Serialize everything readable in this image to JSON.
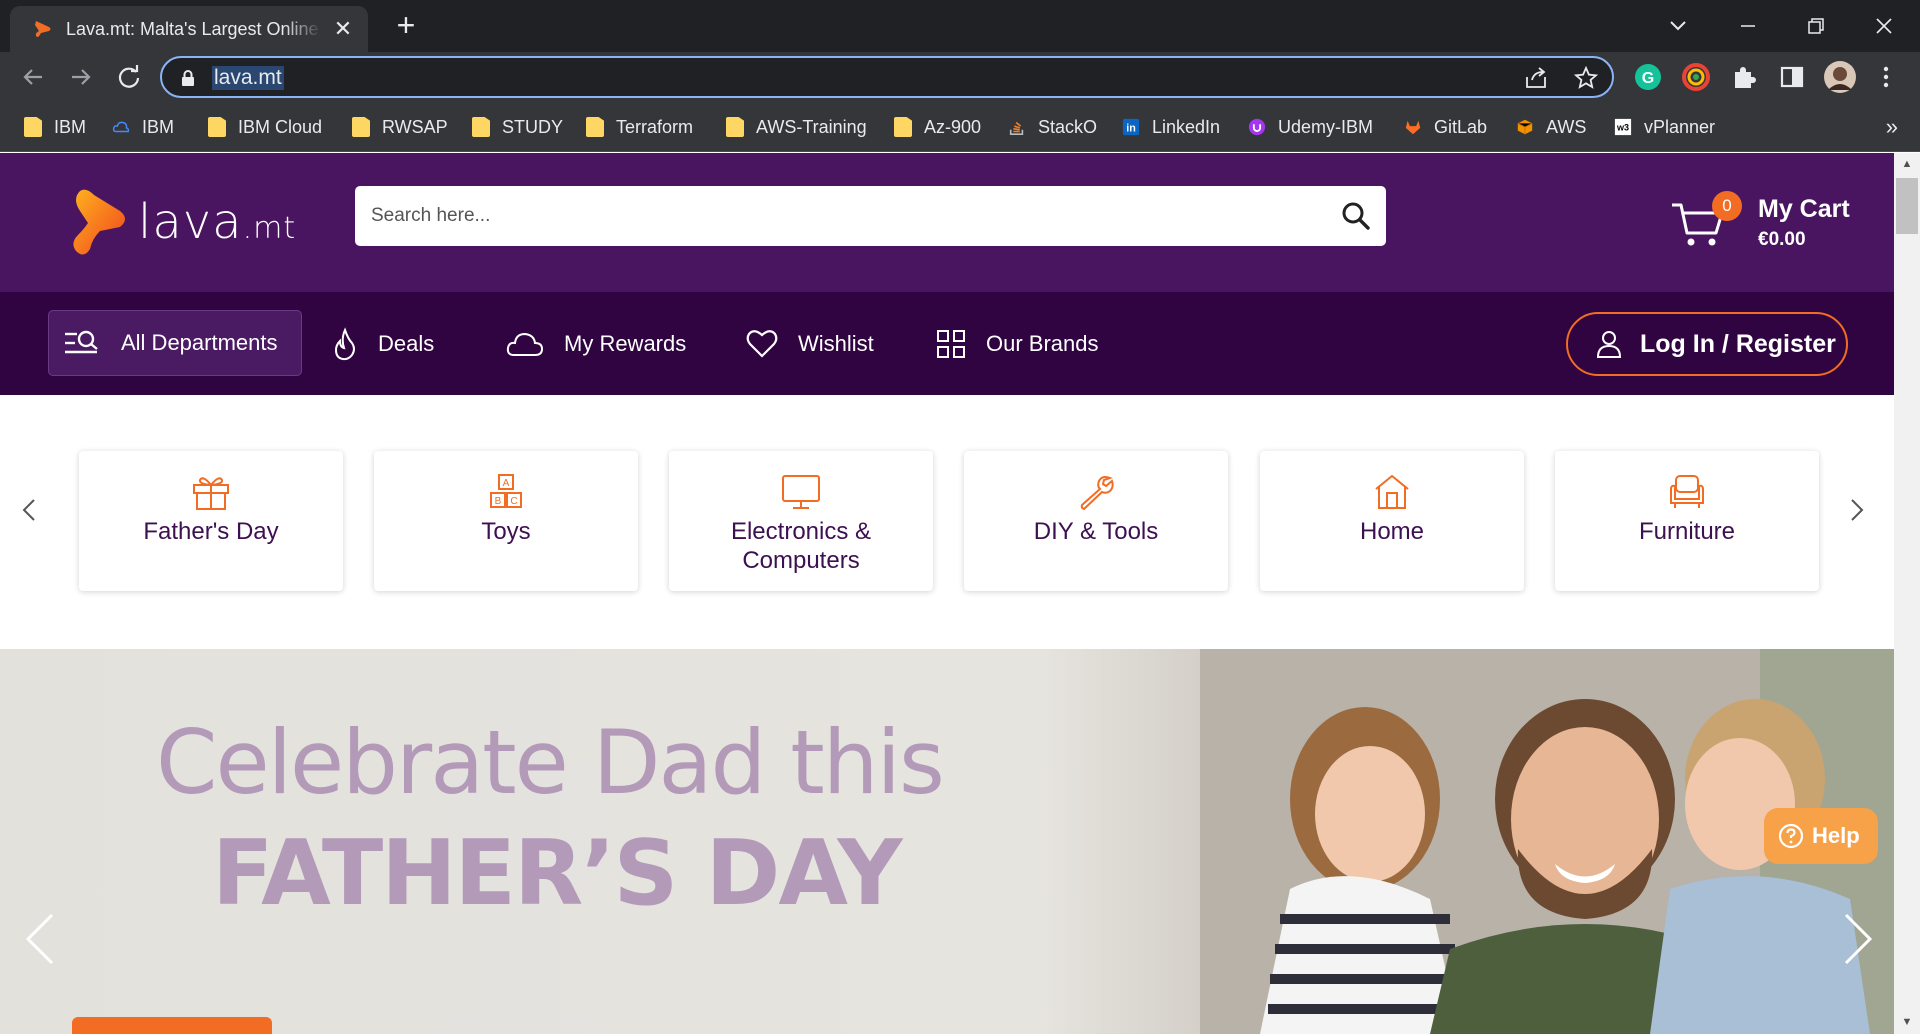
{
  "browser": {
    "tab_title": "Lava.mt: Malta's Largest Online Marketplace",
    "close_glyph": "✕",
    "new_tab_glyph": "+",
    "url": "lava.mt",
    "bookmarks": [
      {
        "label": "IBM",
        "icon": "folder-icon"
      },
      {
        "label": "IBM",
        "icon": "ibm-cloud-icon"
      },
      {
        "label": "IBM Cloud",
        "icon": "folder-icon"
      },
      {
        "label": "RWSAP",
        "icon": "folder-icon"
      },
      {
        "label": "STUDY",
        "icon": "folder-icon"
      },
      {
        "label": "Terraform",
        "icon": "folder-icon"
      },
      {
        "label": "AWS-Training",
        "icon": "folder-icon"
      },
      {
        "label": "Az-900",
        "icon": "folder-icon"
      },
      {
        "label": "StackO",
        "icon": "stackoverflow-icon"
      },
      {
        "label": "LinkedIn",
        "icon": "linkedin-icon"
      },
      {
        "label": "Udemy-IBM",
        "icon": "udemy-icon"
      },
      {
        "label": "GitLab",
        "icon": "gitlab-icon"
      },
      {
        "label": "AWS",
        "icon": "aws-icon"
      },
      {
        "label": "vPlanner",
        "icon": "w3-icon"
      }
    ],
    "bookmarks_more": "»"
  },
  "site": {
    "logo_text": "lava",
    "logo_suffix": ".mt",
    "search_placeholder": "Search here...",
    "cart": {
      "count": "0",
      "title": "My Cart",
      "total": "€0.00"
    },
    "nav": {
      "departments": "All Departments",
      "deals": "Deals",
      "rewards": "My Rewards",
      "wishlist": "Wishlist",
      "brands": "Our Brands",
      "login": "Log In / Register"
    },
    "categories": [
      {
        "label": "Father's Day",
        "icon": "gift-icon"
      },
      {
        "label": "Toys",
        "icon": "abc-blocks-icon"
      },
      {
        "label": "Electronics & Computers",
        "icon": "monitor-icon"
      },
      {
        "label": "DIY & Tools",
        "icon": "wrench-icon"
      },
      {
        "label": "Home",
        "icon": "house-icon"
      },
      {
        "label": "Furniture",
        "icon": "armchair-icon"
      }
    ],
    "banner": {
      "line1": "Celebrate Dad this",
      "line2": "FATHER’S DAY"
    },
    "help_label": "Help"
  },
  "colors": {
    "header_purple": "#4a1560",
    "nav_purple": "#300440",
    "accent_orange": "#f26c23",
    "category_text": "#3d1052",
    "banner_text": "#b39ab8"
  }
}
